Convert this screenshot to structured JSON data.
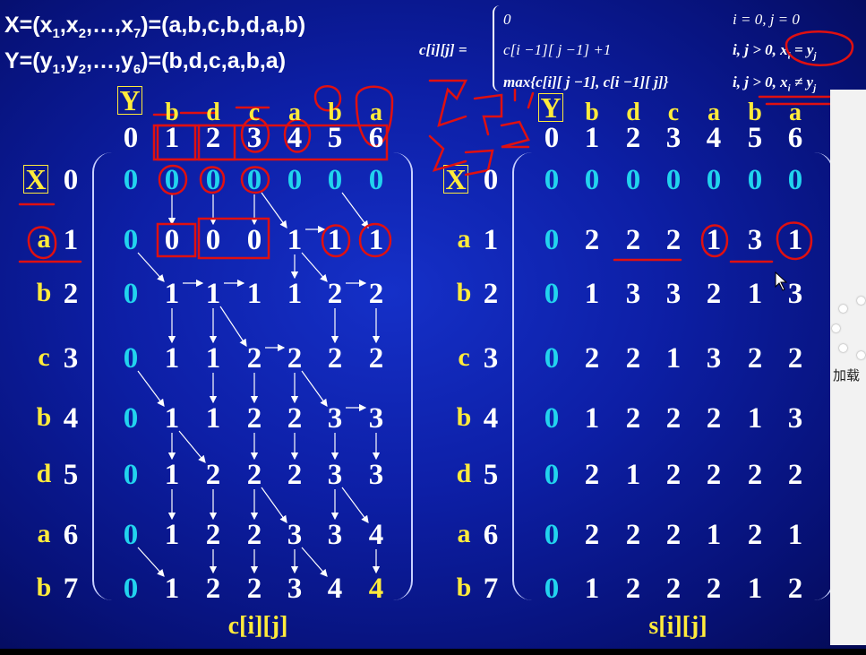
{
  "seq_x": {
    "lead": "X=(x",
    "mid1": ",x",
    "mid2": ",…,x",
    "tail": ")=(a,b,c,b,d,a,b)",
    "s1": "1",
    "s2": "2",
    "s3": "7"
  },
  "seq_y": {
    "lead": "Y=(y",
    "mid1": ",y",
    "mid2": ",…,y",
    "tail": ")=(b,d,c,a,b,a)",
    "s1": "1",
    "s2": "2",
    "s3": "6"
  },
  "formula": {
    "lhs": "c[i][j] =",
    "case1_expr": "0",
    "case1_cond": "i = 0, j = 0",
    "case2_expr": "c[i −1][ j −1] +1",
    "case2_cond": "i, j > 0, x",
    "case2_cond_tail": " = y",
    "case2_sub_i": "i",
    "case2_sub_j": "j",
    "case3_expr": "max{c[i][ j −1], c[i −1][ j]}",
    "case3_cond": "i, j > 0, x",
    "case3_cond_tail": " ≠ y",
    "case3_sub_i": "i",
    "case3_sub_j": "j"
  },
  "labels": {
    "y_axis": "Y",
    "x_axis": "X",
    "c_title": "c[i][j]",
    "s_title": "s[i][j]",
    "loading": "加载"
  },
  "col_letters": [
    "b",
    "d",
    "c",
    "a",
    "b",
    "a"
  ],
  "col_nums": [
    "0",
    "1",
    "2",
    "3",
    "4",
    "5",
    "6"
  ],
  "row_letters": [
    "",
    "a",
    "b",
    "c",
    "b",
    "d",
    "a",
    "b"
  ],
  "row_nums": [
    "0",
    "1",
    "2",
    "3",
    "4",
    "5",
    "6",
    "7"
  ],
  "c_matrix": [
    [
      "0",
      "0",
      "0",
      "0",
      "0",
      "0",
      "0"
    ],
    [
      "0",
      "0",
      "0",
      "0",
      "1",
      "1",
      "1"
    ],
    [
      "0",
      "1",
      "1",
      "1",
      "1",
      "2",
      "2"
    ],
    [
      "0",
      "1",
      "1",
      "2",
      "2",
      "2",
      "2"
    ],
    [
      "0",
      "1",
      "1",
      "2",
      "2",
      "3",
      "3"
    ],
    [
      "0",
      "1",
      "2",
      "2",
      "2",
      "3",
      "3"
    ],
    [
      "0",
      "1",
      "2",
      "2",
      "3",
      "3",
      "4"
    ],
    [
      "0",
      "1",
      "2",
      "2",
      "3",
      "4",
      "4"
    ]
  ],
  "s_matrix": [
    [
      "0",
      "0",
      "0",
      "0",
      "0",
      "0",
      "0"
    ],
    [
      "0",
      "2",
      "2",
      "2",
      "1",
      "3",
      "1"
    ],
    [
      "0",
      "1",
      "3",
      "3",
      "2",
      "1",
      "3"
    ],
    [
      "0",
      "2",
      "2",
      "1",
      "3",
      "2",
      "2"
    ],
    [
      "0",
      "1",
      "2",
      "2",
      "2",
      "1",
      "3"
    ],
    [
      "0",
      "2",
      "1",
      "2",
      "2",
      "2",
      "2"
    ],
    [
      "0",
      "2",
      "2",
      "2",
      "1",
      "2",
      "1"
    ],
    [
      "0",
      "1",
      "2",
      "2",
      "2",
      "1",
      "2"
    ]
  ],
  "colors": {
    "cyan": "#22d3ee",
    "yellow": "#ffeb3b",
    "ink": "#e01010",
    "white": "#ffffff"
  }
}
